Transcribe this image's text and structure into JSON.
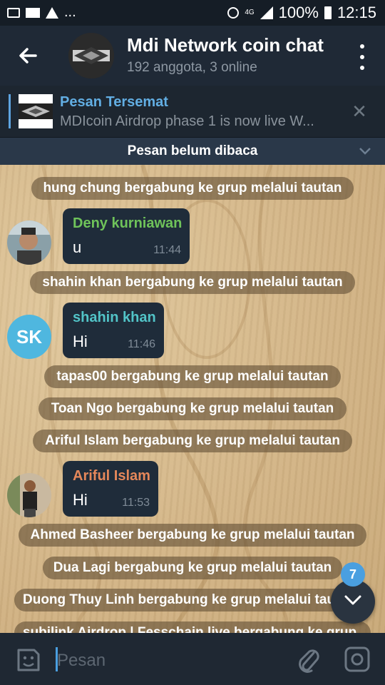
{
  "status_bar": {
    "ellipsis": "...",
    "network": "4G",
    "battery": "100%",
    "time": "12:15"
  },
  "header": {
    "title": "Mdi Network coin chat",
    "subtitle": "192 anggota, 3 online"
  },
  "pinned": {
    "title": "Pesan Tersemat",
    "text": "MDIcoin Airdrop phase 1 is now live W..."
  },
  "unread_banner": "Pesan belum dibaca",
  "messages": {
    "sys1": "hung chung bergabung ke grup melalui tautan",
    "deny": {
      "name": "Deny kurniawan",
      "text": "u",
      "time": "11:44"
    },
    "sys2": "shahin khan bergabung ke grup melalui tautan",
    "shahin": {
      "initials": "SK",
      "name": "shahin khan",
      "text": "Hi",
      "time": "11:46"
    },
    "sys3": "tapas00 bergabung ke grup melalui tautan",
    "sys4": "Toan Ngo bergabung ke grup melalui tautan",
    "sys5": "Ariful Islam bergabung ke grup melalui tautan",
    "ariful": {
      "name": "Ariful Islam",
      "text": "Hi",
      "time": "11:53"
    },
    "sys6": "Ahmed Basheer bergabung ke grup melalui tautan",
    "sys7": "Dua Lagi bergabung ke grup melalui tautan",
    "sys8": "Duong Thuy Linh bergabung ke grup melalui tautan",
    "sys9": "subilink Airdrop | Fesschain live bergabung ke grup"
  },
  "unread_count": "7",
  "input": {
    "placeholder": "Pesan"
  },
  "colors": {
    "accent": "#4a9fe0",
    "deny_name": "#6fc35a",
    "shahin_name": "#52c4c8",
    "ariful_name": "#e5875a"
  }
}
